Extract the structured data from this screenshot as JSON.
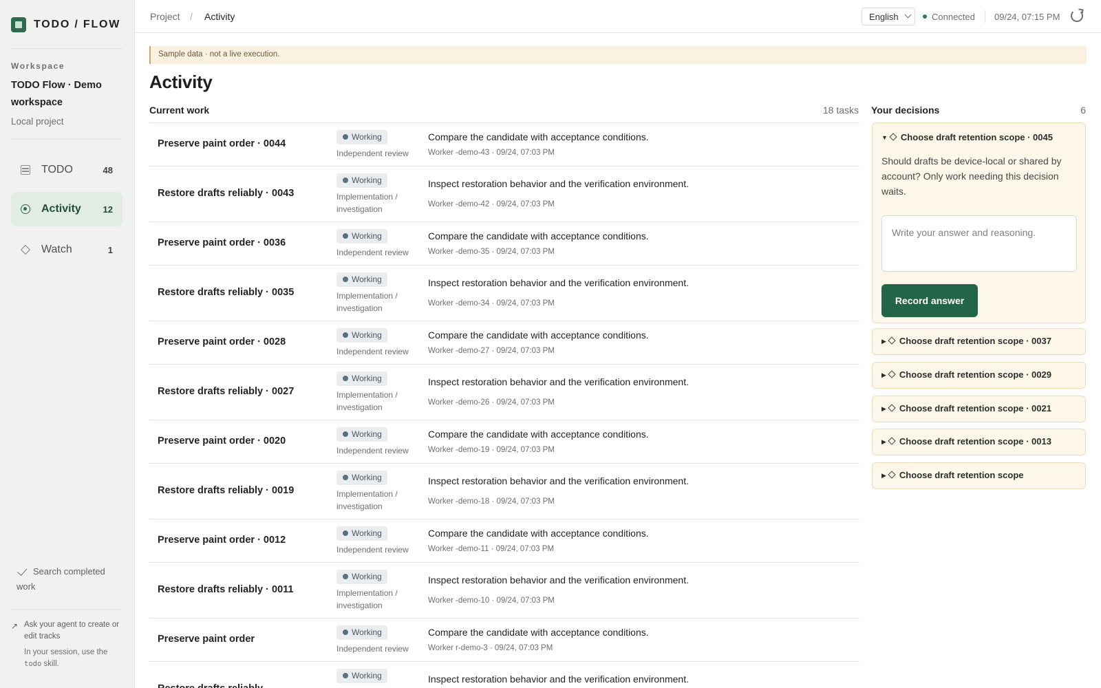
{
  "brand": {
    "name": "TODO / FLOW"
  },
  "workspace": {
    "label": "Workspace",
    "name": "TODO Flow · Demo workspace",
    "sub": "Local project"
  },
  "nav": [
    {
      "label": "TODO",
      "count": "48",
      "icon": "list-icon"
    },
    {
      "label": "Activity",
      "count": "12",
      "icon": "activity-icon",
      "active": true
    },
    {
      "label": "Watch",
      "count": "1",
      "icon": "diamond-icon"
    }
  ],
  "sidebar_footer": {
    "search_completed": "Search completed work",
    "agent_hint": "Ask your agent to create or edit tracks",
    "session_hint_prefix": "In your session, use the",
    "skill": "todo",
    "session_hint_suffix": "skill."
  },
  "topbar": {
    "breadcrumb_project": "Project",
    "breadcrumb_sep": "/",
    "breadcrumb_current": "Activity",
    "language": "English",
    "connection": "Connected",
    "timestamp": "09/24, 07:15 PM"
  },
  "banner": "Sample data · not a live execution.",
  "main": {
    "title": "Activity",
    "section_title": "Current work",
    "task_count": "18 tasks"
  },
  "tasks": [
    {
      "name": "Preserve paint order · 0044",
      "status": "Working",
      "role": "Independent review",
      "desc": "Compare the candidate with acceptance conditions.",
      "meta": "Worker -demo-43 · 09/24, 07:03 PM"
    },
    {
      "name": "Restore drafts reliably · 0043",
      "status": "Working",
      "role": "Implementation / investigation",
      "desc": "Inspect restoration behavior and the verification environment.",
      "meta": "Worker -demo-42 · 09/24, 07:03 PM"
    },
    {
      "name": "Preserve paint order · 0036",
      "status": "Working",
      "role": "Independent review",
      "desc": "Compare the candidate with acceptance conditions.",
      "meta": "Worker -demo-35 · 09/24, 07:03 PM"
    },
    {
      "name": "Restore drafts reliably · 0035",
      "status": "Working",
      "role": "Implementation / investigation",
      "desc": "Inspect restoration behavior and the verification environment.",
      "meta": "Worker -demo-34 · 09/24, 07:03 PM"
    },
    {
      "name": "Preserve paint order · 0028",
      "status": "Working",
      "role": "Independent review",
      "desc": "Compare the candidate with acceptance conditions.",
      "meta": "Worker -demo-27 · 09/24, 07:03 PM"
    },
    {
      "name": "Restore drafts reliably · 0027",
      "status": "Working",
      "role": "Implementation / investigation",
      "desc": "Inspect restoration behavior and the verification environment.",
      "meta": "Worker -demo-26 · 09/24, 07:03 PM"
    },
    {
      "name": "Preserve paint order · 0020",
      "status": "Working",
      "role": "Independent review",
      "desc": "Compare the candidate with acceptance conditions.",
      "meta": "Worker -demo-19 · 09/24, 07:03 PM"
    },
    {
      "name": "Restore drafts reliably · 0019",
      "status": "Working",
      "role": "Implementation / investigation",
      "desc": "Inspect restoration behavior and the verification environment.",
      "meta": "Worker -demo-18 · 09/24, 07:03 PM"
    },
    {
      "name": "Preserve paint order · 0012",
      "status": "Working",
      "role": "Independent review",
      "desc": "Compare the candidate with acceptance conditions.",
      "meta": "Worker -demo-11 · 09/24, 07:03 PM"
    },
    {
      "name": "Restore drafts reliably · 0011",
      "status": "Working",
      "role": "Implementation / investigation",
      "desc": "Inspect restoration behavior and the verification environment.",
      "meta": "Worker -demo-10 · 09/24, 07:03 PM"
    },
    {
      "name": "Preserve paint order",
      "status": "Working",
      "role": "Independent review",
      "desc": "Compare the candidate with acceptance conditions.",
      "meta": "Worker r-demo-3 · 09/24, 07:03 PM"
    },
    {
      "name": "Restore drafts reliably",
      "status": "Working",
      "role": "",
      "desc": "Inspect restoration behavior and the verification environment.",
      "meta": ""
    }
  ],
  "decisions": {
    "title": "Your decisions",
    "count": "6",
    "expanded": {
      "title": "Choose draft retention scope · 0045",
      "body": "Should drafts be device-local or shared by account? Only work needing this decision waits.",
      "placeholder": "Write your answer and reasoning.",
      "button": "Record answer"
    },
    "collapsed": [
      "Choose draft retention scope · 0037",
      "Choose draft retention scope · 0029",
      "Choose draft retention scope · 0021",
      "Choose draft retention scope · 0013",
      "Choose draft retention scope"
    ]
  }
}
